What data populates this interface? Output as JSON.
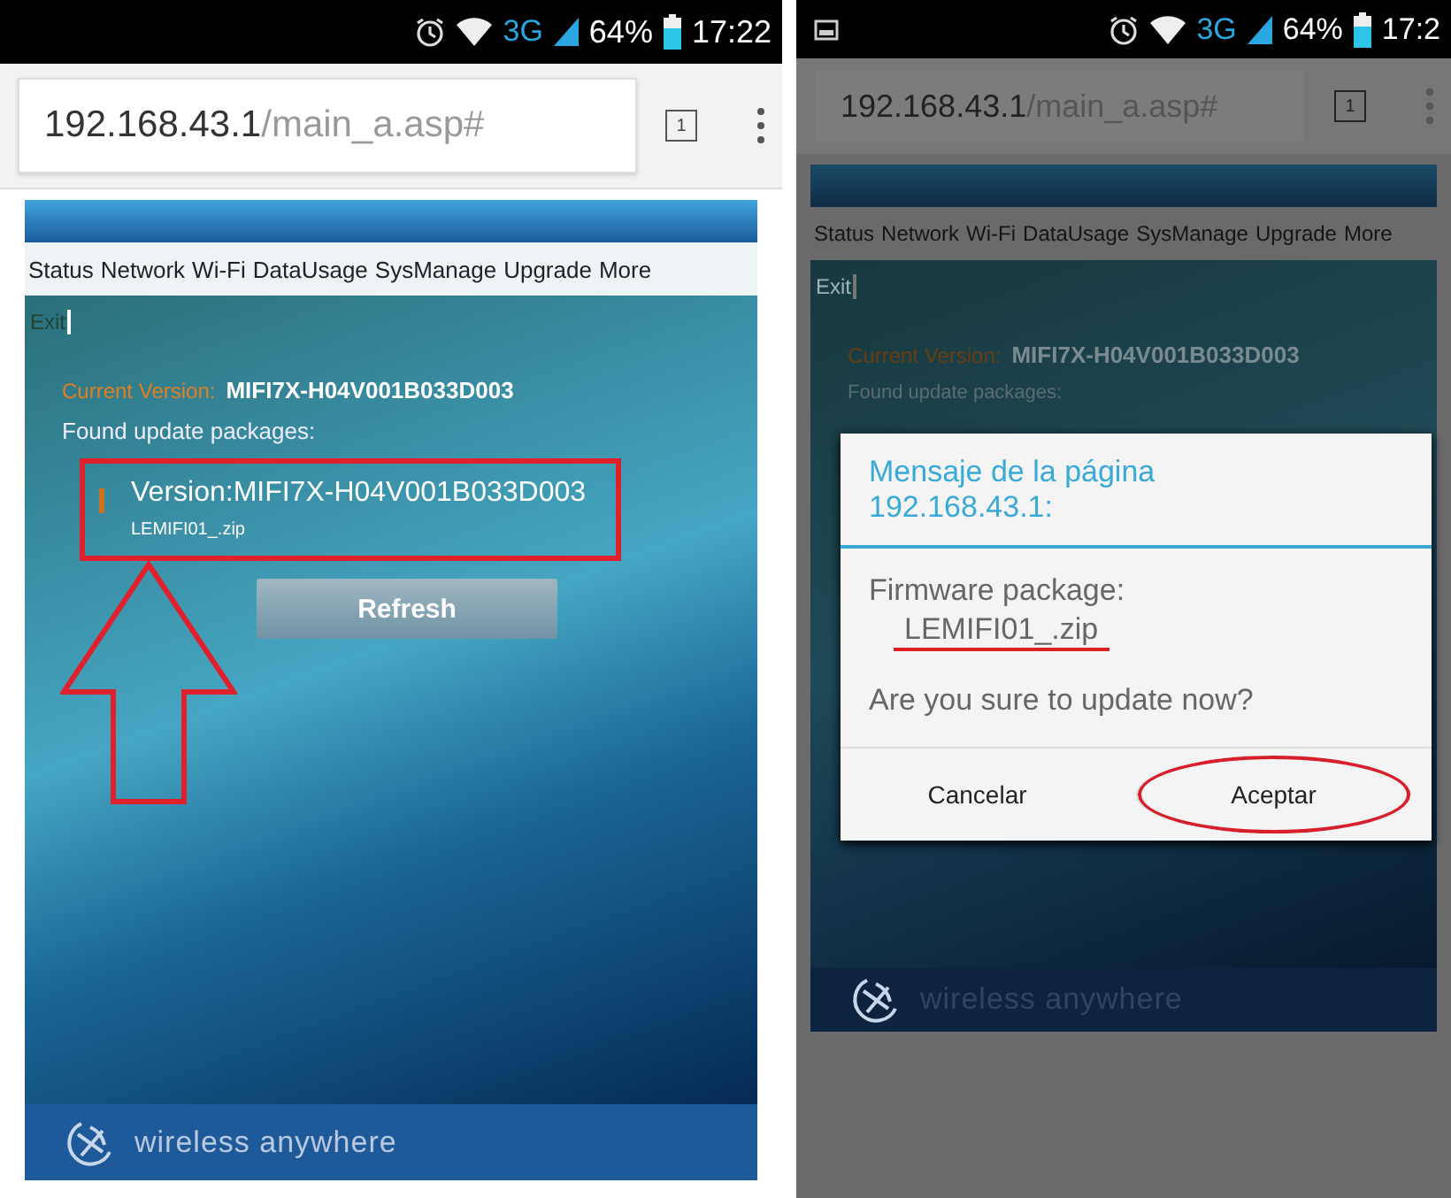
{
  "left_screen": {
    "status_bar": {
      "network": "3G",
      "battery": "64%",
      "time": "17:22",
      "notification_icon": false
    },
    "browser": {
      "url_host": "192.168.43.1",
      "url_path": "/main_a.asp#",
      "tab_count": "1"
    },
    "nav": [
      "Status",
      "Network",
      "Wi-Fi",
      "DataUsage",
      "SysManage",
      "Upgrade",
      "More"
    ],
    "exit": "Exit",
    "current_version_label": "Current Version:",
    "current_version": "MIFI7X-H04V001B033D003",
    "found_label": "Found update packages:",
    "package": {
      "version": "Version:MIFI7X-H04V001B033D003",
      "file": "LEMIFI01_.zip",
      "highlighted": true
    },
    "refresh": "Refresh",
    "footer": "wireless anywhere"
  },
  "right_screen": {
    "status_bar": {
      "network": "3G",
      "battery": "64%",
      "time": "17:2",
      "notification_icon": true
    },
    "browser": {
      "url_host": "192.168.43.1",
      "url_path": "/main_a.asp#",
      "tab_count": "1"
    },
    "nav": [
      "Status",
      "Network",
      "Wi-Fi",
      "DataUsage",
      "SysManage",
      "Upgrade",
      "More"
    ],
    "exit": "Exit",
    "current_version_label": "Current Version:",
    "current_version": "MIFI7X-H04V001B033D003",
    "found_label": "Found update packages:",
    "footer": "wireless anywhere",
    "dialog": {
      "title": "Mensaje de la página 192.168.43.1:",
      "label": "Firmware package:",
      "file": "LEMIFI01_.zip",
      "question": "Are you sure to update now?",
      "buttons": [
        {
          "label": "Cancelar",
          "circled": false
        },
        {
          "label": "Aceptar",
          "circled": true
        }
      ]
    }
  }
}
